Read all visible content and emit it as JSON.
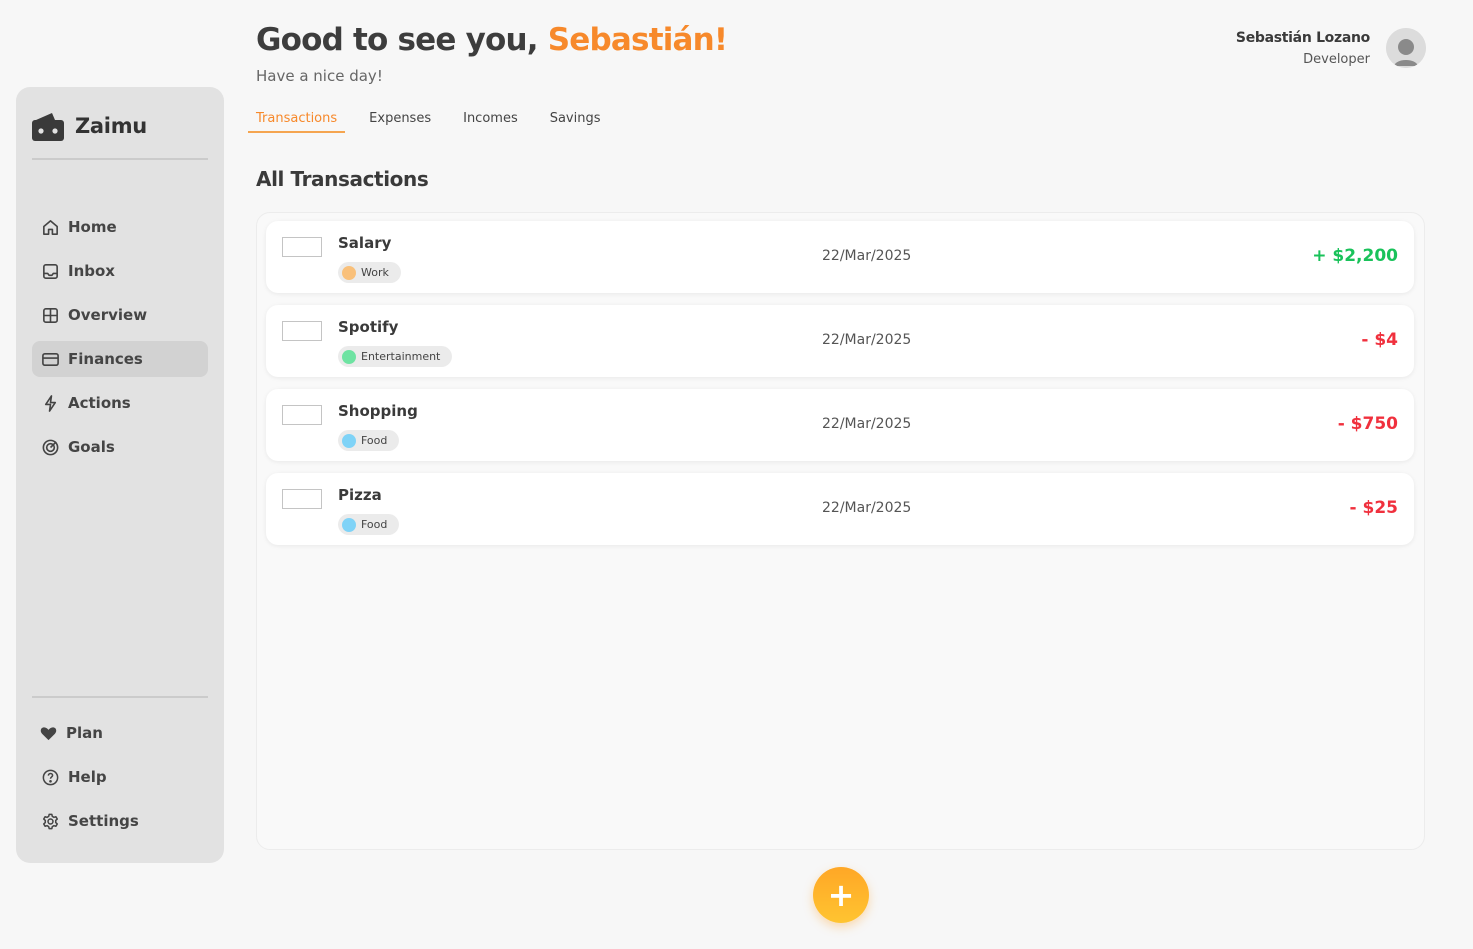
{
  "header": {
    "greeting_prefix": "Good to see you,",
    "greeting_name": "Sebastián!",
    "subtitle": "Have a nice day!",
    "accent_color": "#f7892b"
  },
  "user": {
    "name": "Sebastián Lozano",
    "role": "Developer",
    "avatar_icon": "user-avatar-icon"
  },
  "sidebar": {
    "brand": "Zaimu",
    "brand_icon": "wallet-icon",
    "items": [
      {
        "label": "Home",
        "icon": "home-icon",
        "active": false
      },
      {
        "label": "Inbox",
        "icon": "inbox-icon",
        "active": false
      },
      {
        "label": "Overview",
        "icon": "grid-icon",
        "active": false
      },
      {
        "label": "Finances",
        "icon": "credit-card-icon",
        "active": true
      },
      {
        "label": "Actions",
        "icon": "lightning-icon",
        "active": false
      },
      {
        "label": "Goals",
        "icon": "target-icon",
        "active": false
      }
    ],
    "bottom_items": [
      {
        "label": "Plan",
        "icon": "heart-icon"
      },
      {
        "label": "Help",
        "icon": "help-circle-icon"
      },
      {
        "label": "Settings",
        "icon": "gear-icon"
      }
    ]
  },
  "tabs": [
    {
      "label": "Transactions",
      "active": true
    },
    {
      "label": "Expenses",
      "active": false
    },
    {
      "label": "Incomes",
      "active": false
    },
    {
      "label": "Savings",
      "active": false
    }
  ],
  "section_title": "All Transactions",
  "transactions": [
    {
      "name": "Salary",
      "tag": "Work",
      "tag_color": "#f9c07a",
      "date": "22/Mar/2025",
      "amount": "+ $2,200",
      "positive": true
    },
    {
      "name": "Spotify",
      "tag": "Entertainment",
      "tag_color": "#6ee3a2",
      "date": "22/Mar/2025",
      "amount": "- $4",
      "positive": false
    },
    {
      "name": "Shopping",
      "tag": "Food",
      "tag_color": "#7fd3f7",
      "date": "22/Mar/2025",
      "amount": "- $750",
      "positive": false
    },
    {
      "name": "Pizza",
      "tag": "Food",
      "tag_color": "#7fd3f7",
      "date": "22/Mar/2025",
      "amount": "- $25",
      "positive": false
    }
  ],
  "fab": {
    "label": "+",
    "icon": "plus-icon"
  }
}
